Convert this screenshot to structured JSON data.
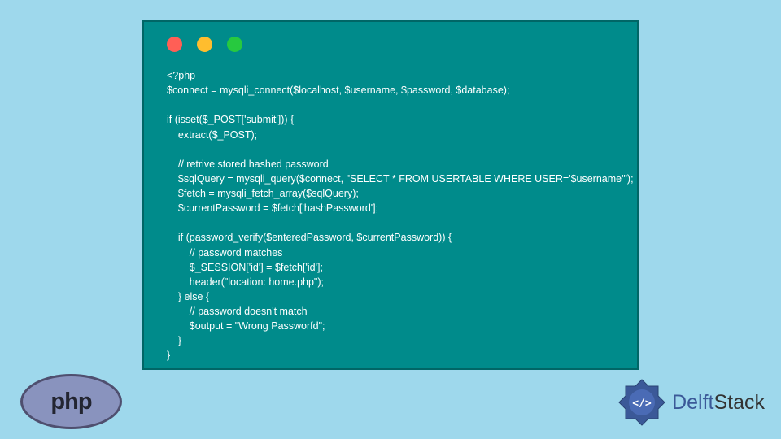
{
  "code": {
    "line1": "<?php",
    "line2": "$connect = mysqli_connect($localhost, $username, $password, $database);",
    "line3": "",
    "line4": "if (isset($_POST['submit'])) {",
    "line5": "    extract($_POST);",
    "line6": "",
    "line7": "    // retrive stored hashed password",
    "line8": "    $sqlQuery = mysqli_query($connect, \"SELECT * FROM USERTABLE WHERE USER='$username'\");",
    "line9": "    $fetch = mysqli_fetch_array($sqlQuery);",
    "line10": "    $currentPassword = $fetch['hashPassword'];",
    "line11": "",
    "line12": "    if (password_verify($enteredPassword, $currentPassword)) {",
    "line13": "        // password matches",
    "line14": "        $_SESSION['id'] = $fetch['id'];",
    "line15": "        header(\"location: home.php\");",
    "line16": "    } else {",
    "line17": "        // password doesn't match",
    "line18": "        $output = \"Wrong Passworfd\";",
    "line19": "    }",
    "line20": "}"
  },
  "logos": {
    "php": "php",
    "delft_first": "Delft",
    "delft_second": "Stack"
  }
}
